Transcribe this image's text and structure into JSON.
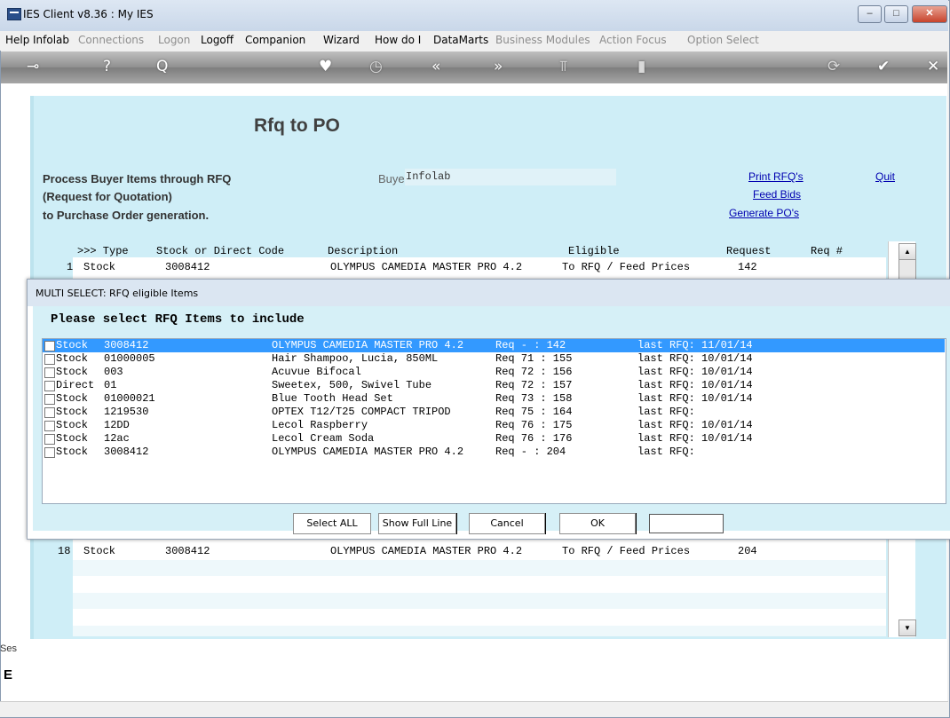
{
  "window": {
    "title": "IES Client v8.36 : My IES",
    "minimize": "–",
    "maximize": "□",
    "close": "✕"
  },
  "menu": [
    "Help",
    "Infolab",
    "Connections",
    "Logon",
    "Logoff",
    "Companion",
    "Wizard",
    "How do I",
    "DataMarts",
    "Business Modules",
    "Action Focus",
    "Option Select"
  ],
  "toolbar_icons": [
    "key-icon",
    "help-icon",
    "search-icon",
    "heart-icon",
    "clock-icon",
    "back-icon",
    "forward-icon",
    "tools-icon",
    "bookmark-icon",
    "refresh-icon",
    "check-icon",
    "close-icon"
  ],
  "header": {
    "title": "Rfq to PO",
    "desc1": "Process Buyer Items through RFQ",
    "desc2": "(Request for Quotation)",
    "desc3": "to Purchase Order generation.",
    "buyer_label": "Buyer",
    "buyer_value": "Infolab"
  },
  "links": {
    "print": "Print RFQ's",
    "feed": "Feed Bids",
    "generate": "Generate PO's",
    "quit": "Quit"
  },
  "grid": {
    "headers": {
      "type": ">>> Type",
      "code": "Stock or Direct Code",
      "desc": "Description",
      "eligible": "Eligible",
      "request": "Request",
      "reqno": "Req #"
    },
    "rows": [
      {
        "num": "1",
        "type": "Stock",
        "code": "3008412",
        "desc": "OLYMPUS CAMEDIA MASTER PRO 4.2",
        "eligible": "To RFQ / Feed Prices",
        "request": "142"
      },
      {
        "num": "18",
        "type": "Stock",
        "code": "3008412",
        "desc": "OLYMPUS CAMEDIA MASTER PRO 4.2",
        "eligible": "To RFQ / Feed Prices",
        "request": "204"
      }
    ]
  },
  "dialog": {
    "title": "MULTI SELECT: RFQ eligible Items",
    "prompt": "Please select RFQ Items to include",
    "items": [
      {
        "type": "Stock",
        "code": "3008412",
        "desc": "OLYMPUS CAMEDIA MASTER PRO 4.2",
        "req": "Req - : 142",
        "last": "last RFQ: 11/01/14",
        "selected": true
      },
      {
        "type": "Stock",
        "code": "01000005",
        "desc": "Hair Shampoo, Lucia, 850ML",
        "req": "Req 71 : 155",
        "last": "last RFQ: 10/01/14",
        "selected": false
      },
      {
        "type": "Stock",
        "code": "003",
        "desc": "Acuvue Bifocal",
        "req": "Req 72 : 156",
        "last": "last RFQ: 10/01/14",
        "selected": false
      },
      {
        "type": "Direct",
        "code": "01",
        "desc": "Sweetex, 500, Swivel Tube",
        "req": "Req 72 : 157",
        "last": "last RFQ: 10/01/14",
        "selected": false
      },
      {
        "type": "Stock",
        "code": "01000021",
        "desc": "Blue Tooth Head Set",
        "req": "Req 73 : 158",
        "last": "last RFQ: 10/01/14",
        "selected": false
      },
      {
        "type": "Stock",
        "code": "1219530",
        "desc": "OPTEX T12/T25 COMPACT TRIPOD",
        "req": "Req 75 : 164",
        "last": "last RFQ:",
        "selected": false
      },
      {
        "type": "Stock",
        "code": "12DD",
        "desc": "Lecol Raspberry",
        "req": "Req 76 : 175",
        "last": "last RFQ: 10/01/14",
        "selected": false
      },
      {
        "type": "Stock",
        "code": "12ac",
        "desc": "Lecol Cream Soda",
        "req": "Req 76 : 176",
        "last": "last RFQ: 10/01/14",
        "selected": false
      },
      {
        "type": "Stock",
        "code": "3008412",
        "desc": "OLYMPUS CAMEDIA MASTER PRO 4.2",
        "req": "Req - : 204",
        "last": "last RFQ:",
        "selected": false
      }
    ],
    "buttons": {
      "select_all": "Select ALL",
      "show_full": "Show Full Line",
      "cancel": "Cancel",
      "ok": "OK"
    },
    "input_value": ""
  },
  "session": {
    "label": "Ses",
    "icon": "E"
  },
  "colors": {
    "panel": "#cfeef7",
    "selection": "#3399ff",
    "link": "#0000b0"
  }
}
